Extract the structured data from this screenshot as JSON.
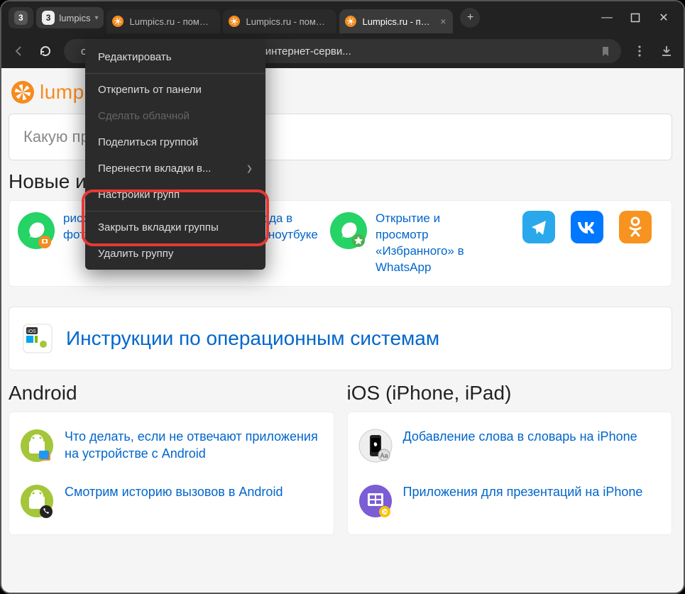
{
  "tabbar": {
    "group_count_left": "3",
    "group_count_right": "3",
    "group_label": "lumpics",
    "tabs": [
      {
        "title": "Lumpics.ru - помощь",
        "active": false
      },
      {
        "title": "Lumpics.ru - помощь",
        "active": false
      },
      {
        "title": "Lumpics.ru - помо",
        "active": true
      }
    ],
    "newtab": "+"
  },
  "addrbar": {
    "url_display": "ощь с компьютерами, телефонами и интернет-серви..."
  },
  "window_controls": {
    "min": "—",
    "max": "▢",
    "close": "✕"
  },
  "page": {
    "logo_text": "lumpics",
    "search_placeholder": "Какую пр",
    "new_section_title": "Новые ин",
    "articles": [
      {
        "text": "рисования на фото в WhatsApp"
      },
      {
        "text": "анты входа в BIOS на ноутбуке Lenovo"
      },
      {
        "text": "Открытие и просмотр «Избранного» в WhatsApp"
      }
    ],
    "os_banner": "Инструкции по операционным системам",
    "android": {
      "title": "Android",
      "items": [
        "Что делать, если не отвечают приложения на устройстве с Android",
        "Смотрим историю вызовов в Android"
      ]
    },
    "ios": {
      "title": "iOS (iPhone, iPad)",
      "items": [
        "Добавление слова в словарь на iPhone",
        "Приложения для презентаций на iPhone"
      ]
    }
  },
  "ctx": {
    "items": [
      {
        "label": "Редактировать",
        "type": "item"
      },
      {
        "type": "sep"
      },
      {
        "label": "Открепить от панели",
        "type": "item"
      },
      {
        "label": "Сделать облачной",
        "type": "disabled"
      },
      {
        "label": "Поделиться группой",
        "type": "item"
      },
      {
        "label": "Перенести вкладки в...",
        "type": "submenu"
      },
      {
        "label": "Настройки групп",
        "type": "item"
      },
      {
        "type": "sep"
      },
      {
        "label": "Закрыть вкладки группы",
        "type": "item"
      },
      {
        "label": "Удалить группу",
        "type": "item"
      }
    ]
  }
}
